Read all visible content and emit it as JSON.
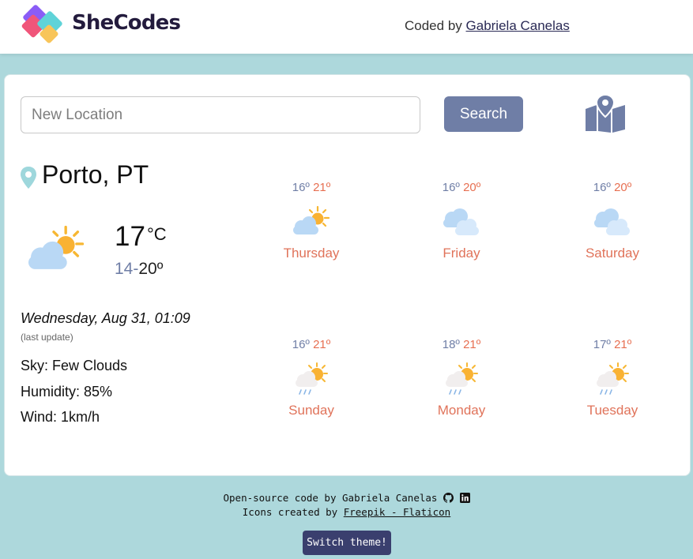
{
  "header": {
    "brand": "SheCodes",
    "coded_by_prefix": "Coded by",
    "coded_by_name": "Gabriela Canelas"
  },
  "search": {
    "placeholder": "New Location",
    "button_label": "Search",
    "map_icon": "folded-map-pin-icon"
  },
  "current": {
    "city": "Porto, PT",
    "icon": "sun-behind-cloud-icon",
    "temp": "17",
    "unit": "°C",
    "min": "14-",
    "max": "20º",
    "date": "Wednesday, Aug 31, 01:09",
    "last_update": "(last update)",
    "sky": "Sky: Few Clouds",
    "humidity": "Humidity: 85%",
    "wind": "Wind: 1km/h"
  },
  "forecast": [
    {
      "day": "Thursday",
      "min": "16º ",
      "max": "21º",
      "icon": "sun-behind-cloud-icon"
    },
    {
      "day": "Friday",
      "min": "16º ",
      "max": "20º",
      "icon": "clouds-icon"
    },
    {
      "day": "Saturday",
      "min": "16º ",
      "max": "20º",
      "icon": "clouds-icon"
    },
    {
      "day": "Sunday",
      "min": "16º ",
      "max": "21º",
      "icon": "sun-cloud-rain-icon"
    },
    {
      "day": "Monday",
      "min": "18º ",
      "max": "21º",
      "icon": "sun-cloud-rain-icon"
    },
    {
      "day": "Tuesday",
      "min": "17º ",
      "max": "21º",
      "icon": "sun-cloud-rain-icon"
    }
  ],
  "footer": {
    "open_source_text": "Open-source code by Gabriela Canelas",
    "icons_prefix": "Icons created by",
    "icons_link": "Freepik - Flaticon",
    "theme_button": "Switch theme!"
  },
  "colors": {
    "background": "#add8dc",
    "accent": "#6f7ea6",
    "max_temp": "#e76f51",
    "theme_button": "#3a3f6e"
  }
}
